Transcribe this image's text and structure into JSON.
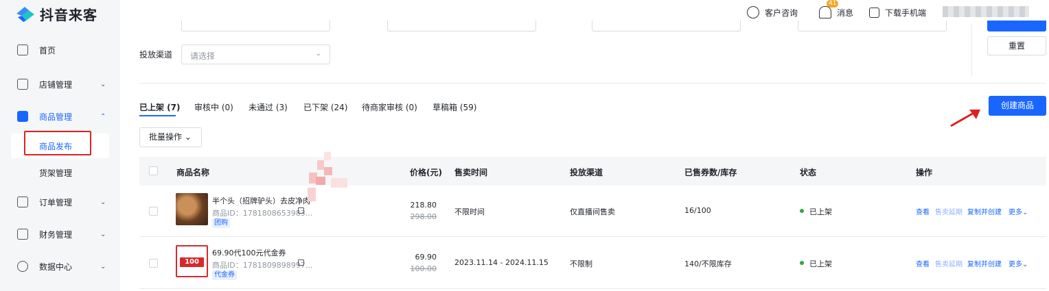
{
  "app": {
    "logo_text": "抖音来客"
  },
  "sidebar": {
    "items": [
      {
        "label": "首页",
        "icon": "home-icon"
      },
      {
        "label": "店铺管理",
        "icon": "store-icon",
        "chevron": "⌄"
      },
      {
        "label": "商品管理",
        "icon": "bag-icon",
        "chevron": "⌃"
      },
      {
        "label": "商品发布"
      },
      {
        "label": "货架管理"
      },
      {
        "label": "订单管理",
        "icon": "clipboard-icon",
        "chevron": "⌄"
      },
      {
        "label": "财务管理",
        "icon": "wallet-icon",
        "chevron": "⌄"
      },
      {
        "label": "数据中心",
        "icon": "pie-chart-icon",
        "chevron": "⌄"
      }
    ]
  },
  "header": {
    "consult_label": "客户咨询",
    "message_label": "消息",
    "message_badge": "41",
    "download_label": "下载手机端"
  },
  "filters": {
    "channel_label": "投放渠道",
    "channel_placeholder": "请选择",
    "reset_label": "重置"
  },
  "tabs": [
    {
      "label": "已上架 (7)"
    },
    {
      "label": "审核中 (0)"
    },
    {
      "label": "未通过 (3)"
    },
    {
      "label": "已下架 (24)"
    },
    {
      "label": "待商家审核 (0)"
    },
    {
      "label": "草稿箱 (59)"
    }
  ],
  "toolbar": {
    "create_label": "创建商品",
    "batch_label": "批量操作 ⌄"
  },
  "table": {
    "headers": [
      "商品名称",
      "价格(元)",
      "售卖时间",
      "投放渠道",
      "已售券数/库存",
      "状态",
      "操作"
    ],
    "rows": [
      {
        "name": "半个头（招牌驴头）去皮净肉",
        "id": "商品ID：1781808653983...",
        "tag": "团购",
        "price": "218.80",
        "original_price": "298.00",
        "sale_time": "不限时间",
        "channel": "仅直播间售卖",
        "sold_stock": "16/100",
        "status": "已上架",
        "actions": [
          "查看",
          "售卖延期",
          "复制并创建",
          "更多⌄"
        ]
      },
      {
        "name": "69.90代100元代金券",
        "id": "商品ID：1781809898997...",
        "tag": "代金券",
        "thumb_text": "100",
        "price": "69.90",
        "original_price": "100.00",
        "sale_time": "2023.11.14 - 2024.11.15",
        "channel": "不限制",
        "sold_stock": "140/不限库存",
        "status": "已上架",
        "actions": [
          "查看",
          "售卖延期",
          "复制并创建",
          "更多⌄"
        ]
      }
    ]
  },
  "colors": {
    "accent": "#1966ff",
    "status_green": "#32a645",
    "highlight_red": "#e02020"
  }
}
